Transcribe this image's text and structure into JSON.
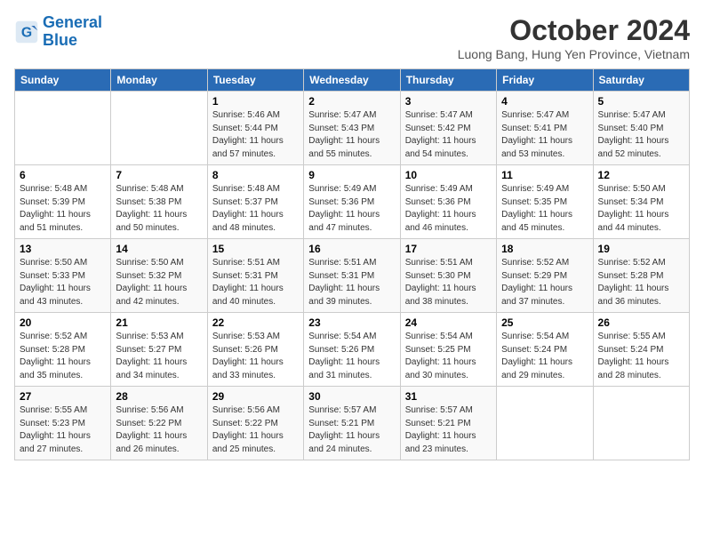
{
  "logo": {
    "line1": "General",
    "line2": "Blue"
  },
  "title": "October 2024",
  "subtitle": "Luong Bang, Hung Yen Province, Vietnam",
  "weekdays": [
    "Sunday",
    "Monday",
    "Tuesday",
    "Wednesday",
    "Thursday",
    "Friday",
    "Saturday"
  ],
  "weeks": [
    [
      {
        "day": "",
        "info": ""
      },
      {
        "day": "",
        "info": ""
      },
      {
        "day": "1",
        "info": "Sunrise: 5:46 AM\nSunset: 5:44 PM\nDaylight: 11 hours and 57 minutes."
      },
      {
        "day": "2",
        "info": "Sunrise: 5:47 AM\nSunset: 5:43 PM\nDaylight: 11 hours and 55 minutes."
      },
      {
        "day": "3",
        "info": "Sunrise: 5:47 AM\nSunset: 5:42 PM\nDaylight: 11 hours and 54 minutes."
      },
      {
        "day": "4",
        "info": "Sunrise: 5:47 AM\nSunset: 5:41 PM\nDaylight: 11 hours and 53 minutes."
      },
      {
        "day": "5",
        "info": "Sunrise: 5:47 AM\nSunset: 5:40 PM\nDaylight: 11 hours and 52 minutes."
      }
    ],
    [
      {
        "day": "6",
        "info": "Sunrise: 5:48 AM\nSunset: 5:39 PM\nDaylight: 11 hours and 51 minutes."
      },
      {
        "day": "7",
        "info": "Sunrise: 5:48 AM\nSunset: 5:38 PM\nDaylight: 11 hours and 50 minutes."
      },
      {
        "day": "8",
        "info": "Sunrise: 5:48 AM\nSunset: 5:37 PM\nDaylight: 11 hours and 48 minutes."
      },
      {
        "day": "9",
        "info": "Sunrise: 5:49 AM\nSunset: 5:36 PM\nDaylight: 11 hours and 47 minutes."
      },
      {
        "day": "10",
        "info": "Sunrise: 5:49 AM\nSunset: 5:36 PM\nDaylight: 11 hours and 46 minutes."
      },
      {
        "day": "11",
        "info": "Sunrise: 5:49 AM\nSunset: 5:35 PM\nDaylight: 11 hours and 45 minutes."
      },
      {
        "day": "12",
        "info": "Sunrise: 5:50 AM\nSunset: 5:34 PM\nDaylight: 11 hours and 44 minutes."
      }
    ],
    [
      {
        "day": "13",
        "info": "Sunrise: 5:50 AM\nSunset: 5:33 PM\nDaylight: 11 hours and 43 minutes."
      },
      {
        "day": "14",
        "info": "Sunrise: 5:50 AM\nSunset: 5:32 PM\nDaylight: 11 hours and 42 minutes."
      },
      {
        "day": "15",
        "info": "Sunrise: 5:51 AM\nSunset: 5:31 PM\nDaylight: 11 hours and 40 minutes."
      },
      {
        "day": "16",
        "info": "Sunrise: 5:51 AM\nSunset: 5:31 PM\nDaylight: 11 hours and 39 minutes."
      },
      {
        "day": "17",
        "info": "Sunrise: 5:51 AM\nSunset: 5:30 PM\nDaylight: 11 hours and 38 minutes."
      },
      {
        "day": "18",
        "info": "Sunrise: 5:52 AM\nSunset: 5:29 PM\nDaylight: 11 hours and 37 minutes."
      },
      {
        "day": "19",
        "info": "Sunrise: 5:52 AM\nSunset: 5:28 PM\nDaylight: 11 hours and 36 minutes."
      }
    ],
    [
      {
        "day": "20",
        "info": "Sunrise: 5:52 AM\nSunset: 5:28 PM\nDaylight: 11 hours and 35 minutes."
      },
      {
        "day": "21",
        "info": "Sunrise: 5:53 AM\nSunset: 5:27 PM\nDaylight: 11 hours and 34 minutes."
      },
      {
        "day": "22",
        "info": "Sunrise: 5:53 AM\nSunset: 5:26 PM\nDaylight: 11 hours and 33 minutes."
      },
      {
        "day": "23",
        "info": "Sunrise: 5:54 AM\nSunset: 5:26 PM\nDaylight: 11 hours and 31 minutes."
      },
      {
        "day": "24",
        "info": "Sunrise: 5:54 AM\nSunset: 5:25 PM\nDaylight: 11 hours and 30 minutes."
      },
      {
        "day": "25",
        "info": "Sunrise: 5:54 AM\nSunset: 5:24 PM\nDaylight: 11 hours and 29 minutes."
      },
      {
        "day": "26",
        "info": "Sunrise: 5:55 AM\nSunset: 5:24 PM\nDaylight: 11 hours and 28 minutes."
      }
    ],
    [
      {
        "day": "27",
        "info": "Sunrise: 5:55 AM\nSunset: 5:23 PM\nDaylight: 11 hours and 27 minutes."
      },
      {
        "day": "28",
        "info": "Sunrise: 5:56 AM\nSunset: 5:22 PM\nDaylight: 11 hours and 26 minutes."
      },
      {
        "day": "29",
        "info": "Sunrise: 5:56 AM\nSunset: 5:22 PM\nDaylight: 11 hours and 25 minutes."
      },
      {
        "day": "30",
        "info": "Sunrise: 5:57 AM\nSunset: 5:21 PM\nDaylight: 11 hours and 24 minutes."
      },
      {
        "day": "31",
        "info": "Sunrise: 5:57 AM\nSunset: 5:21 PM\nDaylight: 11 hours and 23 minutes."
      },
      {
        "day": "",
        "info": ""
      },
      {
        "day": "",
        "info": ""
      }
    ]
  ]
}
